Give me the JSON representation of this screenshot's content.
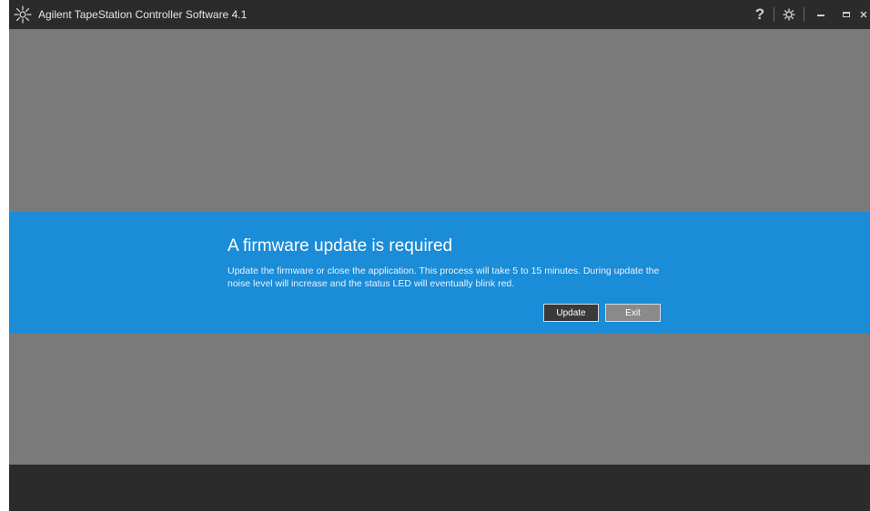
{
  "titlebar": {
    "title": "Agilent TapeStation Controller Software 4.1",
    "logo_icon": "agilent-spark-icon",
    "help_label": "?",
    "settings_icon": "gear-icon",
    "minimize_icon": "minimize-icon",
    "maximize_icon": "maximize-icon",
    "close_icon": "close-icon"
  },
  "banner": {
    "title": "A firmware update is required",
    "message": "Update the firmware or close the application. This process will take 5 to 15 minutes. During update the noise level will increase and the status LED will eventually blink red.",
    "update_label": "Update",
    "exit_label": "Exit"
  },
  "colors": {
    "titlebar": "#2b2b2b",
    "background": "#7a7a7a",
    "banner": "#1a8cd8",
    "bottom_bar": "#2b2b2b"
  }
}
